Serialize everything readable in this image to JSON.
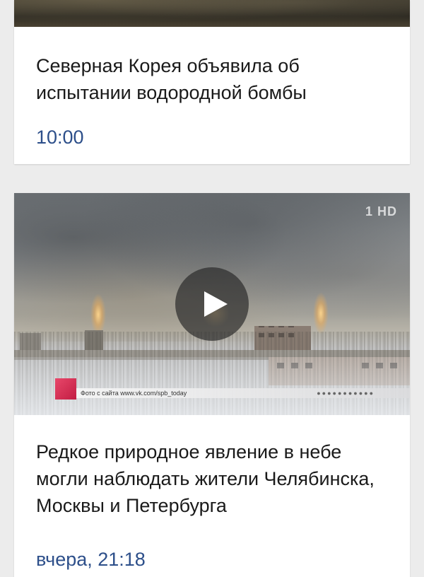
{
  "feed": {
    "items": [
      {
        "title": "Северная Корея объявила об испытании водородной бомбы",
        "time": "10:00"
      },
      {
        "title": "Редкое природное явление в небе могли наблюдать жители Челябинска, Москвы и Петербурга",
        "time": "вчера, 21:18",
        "video": {
          "channel_logo": "1 HD",
          "caption": "Фото с сайта www.vk.com/spb_today",
          "caption_dots": "●●●●●●●●●●●",
          "play_icon": "play-icon"
        }
      }
    ]
  },
  "colors": {
    "background": "#ececec",
    "card": "#ffffff",
    "time_text": "#2d4f8a",
    "title_text": "#1a1a1a",
    "caption_accent": "#c21d43"
  }
}
